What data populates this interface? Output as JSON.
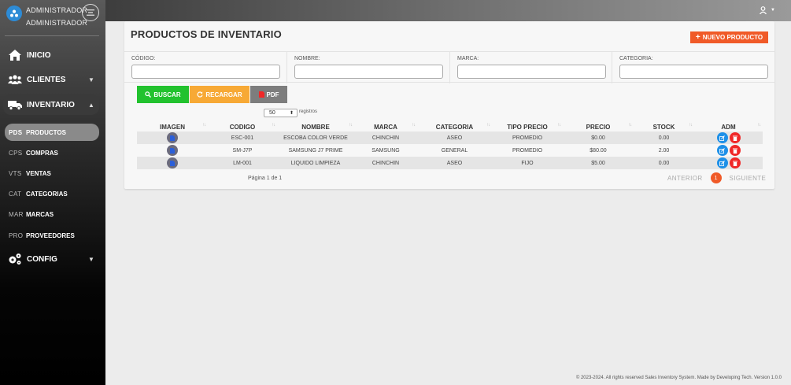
{
  "colors": {
    "accent": "#f05a28",
    "search": "#22c22e",
    "reload": "#f7a935",
    "pdf": "#7d7d7d",
    "edit": "#1e90e8",
    "delete": "#f02828"
  },
  "user": {
    "name_line1": "ADMINISTRADOR",
    "name_line2": "ADMINISTRADOR",
    "icon": "user-circle-icon"
  },
  "nav": {
    "inicio": "INICIO",
    "clientes": "CLIENTES",
    "inventario": "INVENTARIO",
    "config": "CONFIG",
    "sub": [
      {
        "abbr": "PDS",
        "label": "PRODUCTOS"
      },
      {
        "abbr": "CPS",
        "label": "COMPRAS"
      },
      {
        "abbr": "VTS",
        "label": "VENTAS"
      },
      {
        "abbr": "CAT",
        "label": "CATEGORIAS"
      },
      {
        "abbr": "MAR",
        "label": "MARCAS"
      },
      {
        "abbr": "PRO",
        "label": "PROVEEDORES"
      }
    ]
  },
  "header": {
    "title": "PRODUCTOS DE INVENTARIO",
    "new_button": "NUEVO PRODUCTO"
  },
  "filters": {
    "codigo": "CÓDIGO:",
    "nombre": "NOMBRE:",
    "marca": "MARCA:",
    "categoria": "CATEGORIA:"
  },
  "actions": {
    "buscar": "BUSCAR",
    "recargar": "RECARGAR",
    "pdf": "PDF"
  },
  "page_size": {
    "value": "50",
    "suffix": "registros"
  },
  "table": {
    "headers": [
      "IMAGEN",
      "CODIGO",
      "NOMBRE",
      "MARCA",
      "CATEGORIA",
      "TIPO PRECIO",
      "PRECIO",
      "STOCK",
      "ADM"
    ],
    "rows": [
      {
        "codigo": "ESC-001",
        "nombre": "ESCOBA COLOR VERDE",
        "marca": "CHINCHIN",
        "categoria": "ASEO",
        "tipo_precio": "PROMEDIO",
        "precio": "$0.00",
        "stock": "0.00"
      },
      {
        "codigo": "SM-J7P",
        "nombre": "SAMSUNG J7 PRIME",
        "marca": "SAMSUNG",
        "categoria": "GENERAL",
        "tipo_precio": "PROMEDIO",
        "precio": "$80.00",
        "stock": "2.00"
      },
      {
        "codigo": "LM-001",
        "nombre": "LIQUIDO LIMPIEZA",
        "marca": "CHINCHIN",
        "categoria": "ASEO",
        "tipo_precio": "FIJO",
        "precio": "$5.00",
        "stock": "0.00"
      }
    ]
  },
  "pagination": {
    "info": "Página 1 de 1",
    "prev": "ANTERIOR",
    "current": "1",
    "next": "SIGUIENTE"
  },
  "footer": "© 2023-2024. All rights reserved Sales Inventory System. Made by Developing Tech. Version 1.0.0"
}
